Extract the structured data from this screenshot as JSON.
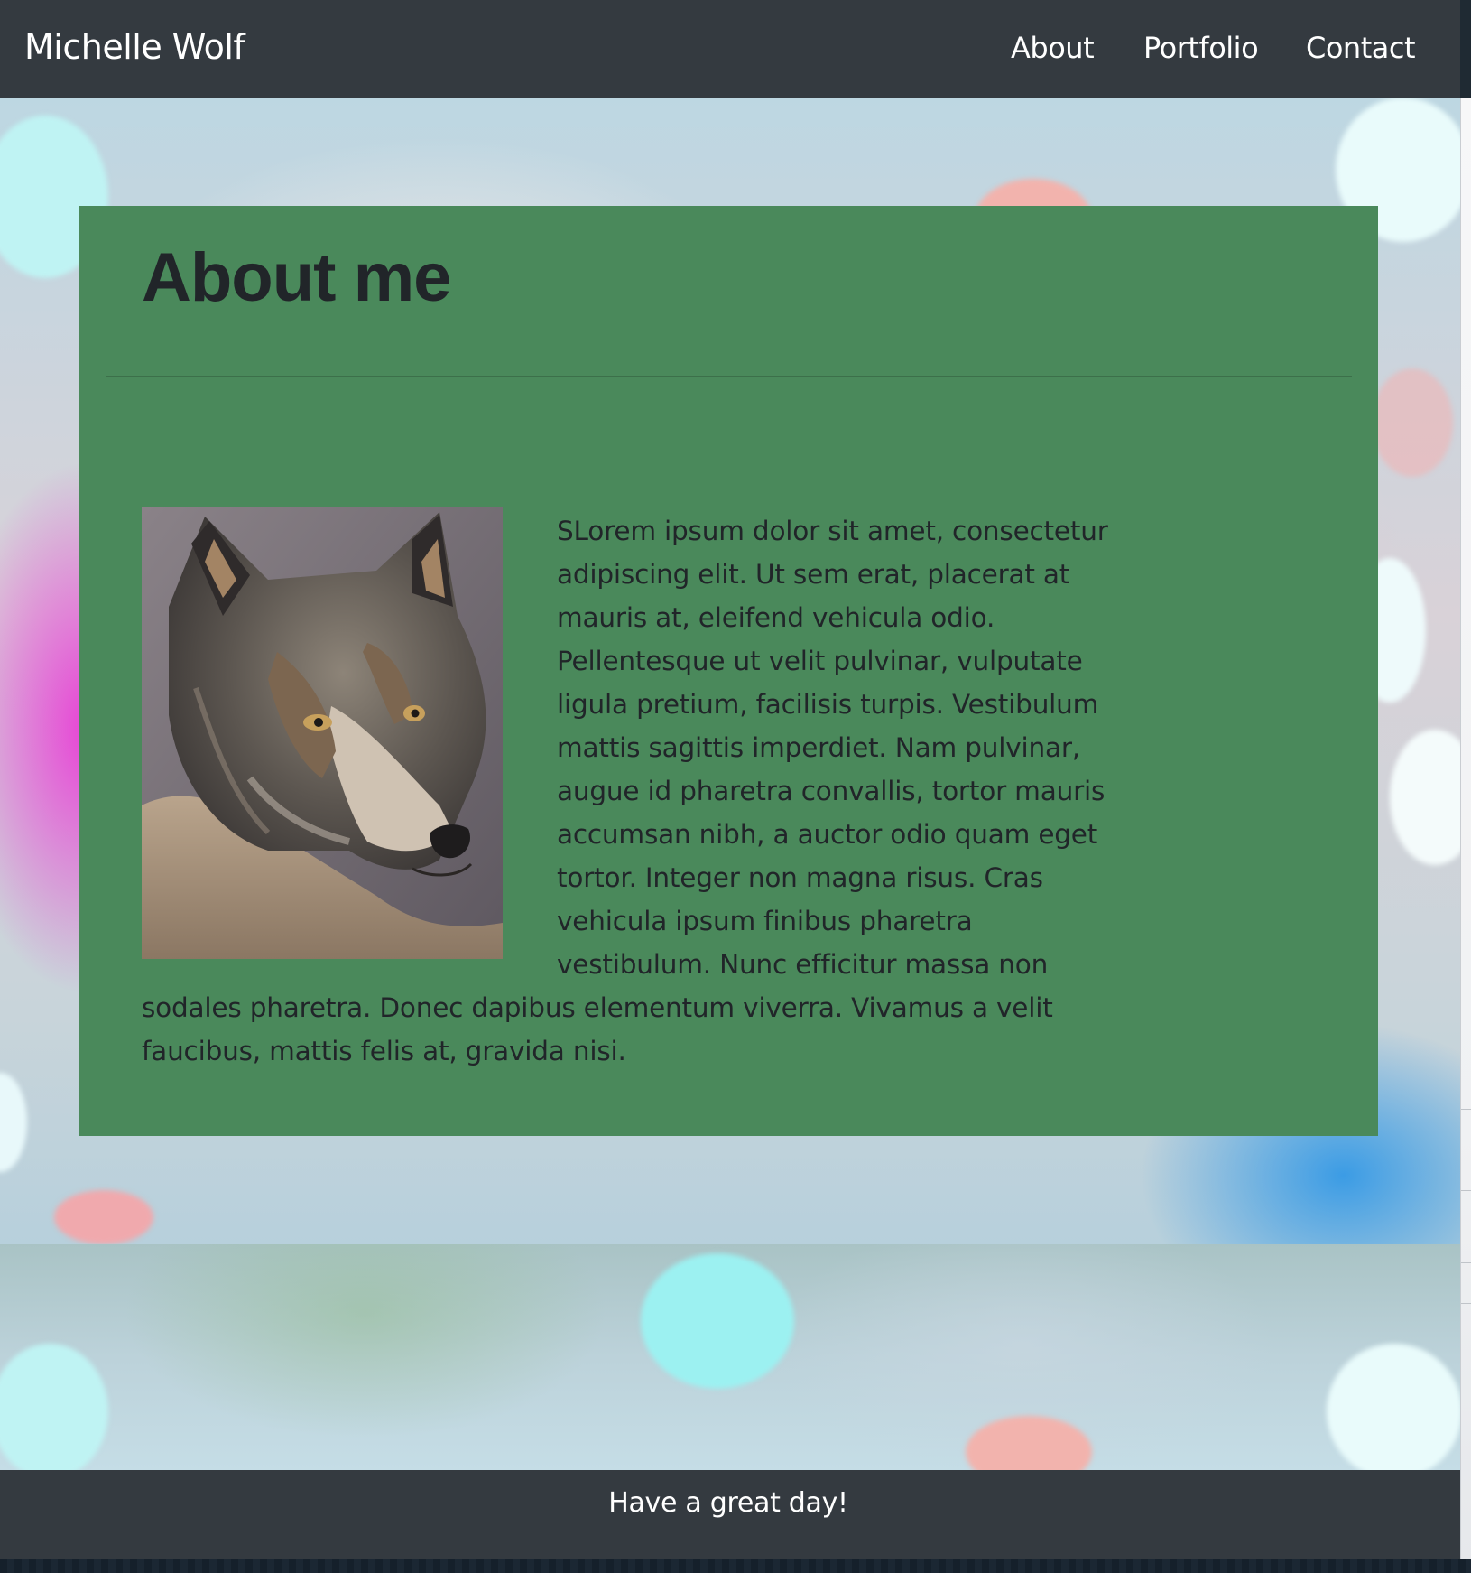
{
  "navbar": {
    "brand": "Michelle Wolf",
    "links": [
      {
        "label": "About"
      },
      {
        "label": "Portfolio"
      },
      {
        "label": "Contact"
      }
    ]
  },
  "about": {
    "heading": "About me",
    "paragraph": "SLorem ipsum dolor sit amet, consectetur adipiscing elit. Ut sem erat, placerat at mauris at, eleifend vehicula odio. Pellentesque ut velit pulvinar, vulputate ligula pretium, facilisis turpis. Vestibulum mattis sagittis imperdiet. Nam pulvinar, augue id pharetra convallis, tortor mauris accumsan nibh, a auctor odio quam eget tortor. Integer non magna risus. Cras vehicula ipsum finibus pharetra vestibulum. Nunc efficitur massa non sodales pharetra. Donec dapibus elementum viverra. Vivamus a velit faucibus, mattis felis at, gravida nisi."
  },
  "footer": {
    "text": "Have a great day!"
  },
  "colors": {
    "navbar_bg": "#343a40",
    "card_bg": "#4a895b",
    "text_dark": "#212529",
    "text_light": "#ffffff"
  }
}
